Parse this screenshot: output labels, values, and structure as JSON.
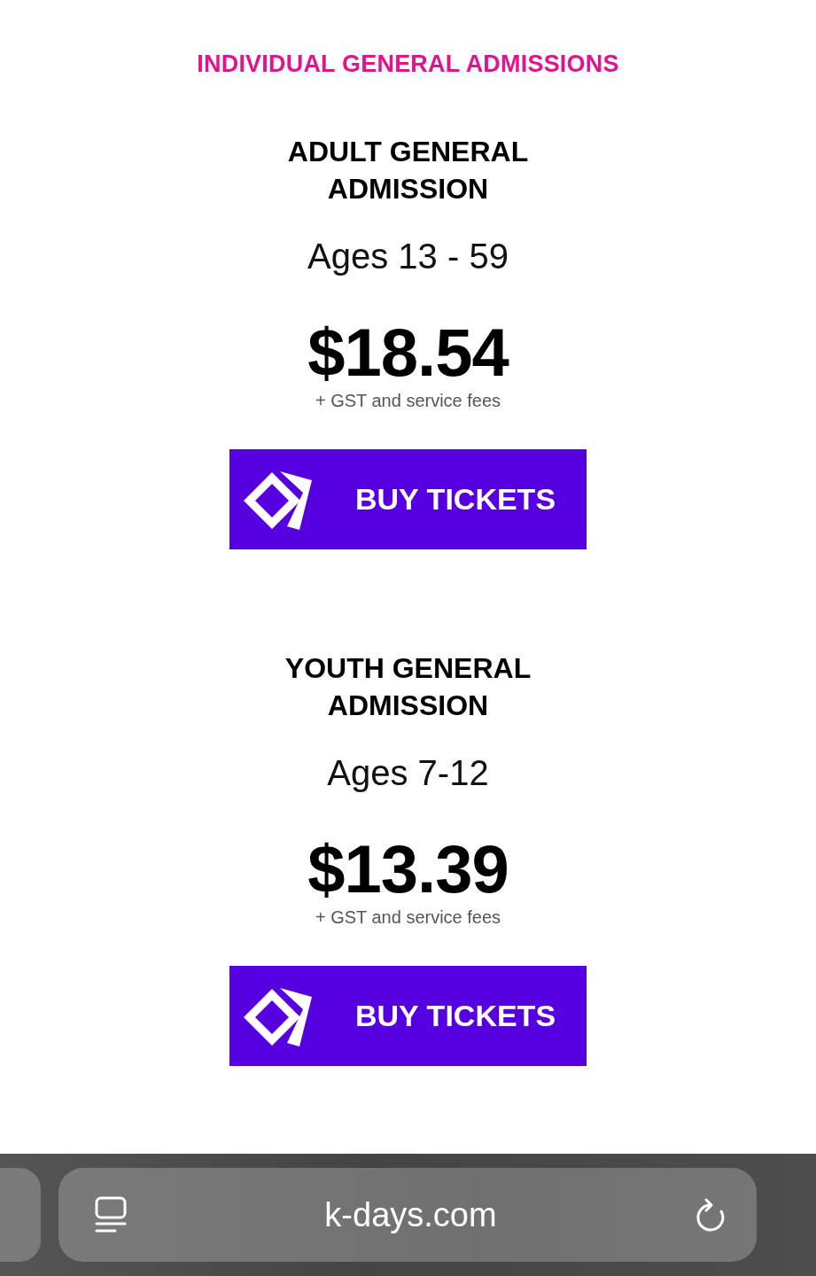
{
  "section_title": "INDIVIDUAL GENERAL ADMISSIONS",
  "tickets": [
    {
      "title": "ADULT GENERAL ADMISSION",
      "ages": "Ages 13 - 59",
      "price": "$18.54",
      "fee_note": "+ GST and service fees",
      "button": "BUY TICKETS"
    },
    {
      "title": "YOUTH GENERAL ADMISSION",
      "ages": "Ages 7-12",
      "price": "$13.39",
      "fee_note": "+ GST and service fees",
      "button": "BUY TICKETS"
    }
  ],
  "browser_bar": {
    "url": "k-days.com"
  }
}
